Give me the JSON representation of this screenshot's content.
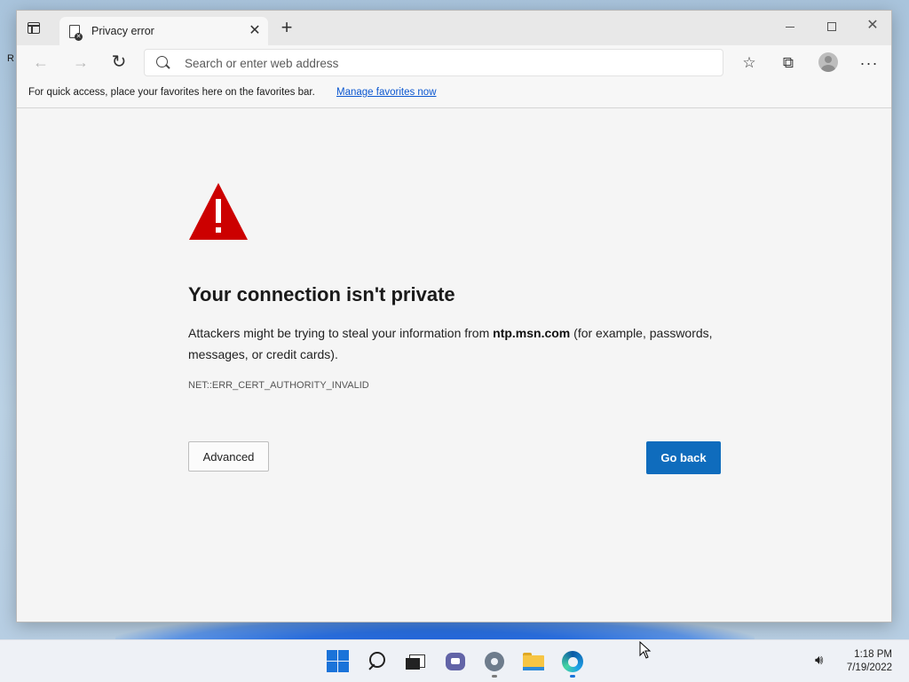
{
  "desktop": {
    "edge_glyph": "R"
  },
  "browser": {
    "tab": {
      "title": "Privacy error",
      "favicon": "error-page-icon"
    },
    "toolbar": {
      "address_placeholder": "Search or enter web address",
      "icons": [
        "back-arrow-icon",
        "forward-arrow-icon",
        "refresh-icon",
        "favorites-icon",
        "collections-icon",
        "profile-avatar",
        "more-icon"
      ]
    },
    "favorites_bar": {
      "text": "For quick access, place your favorites here on the favorites bar.",
      "link": "Manage favorites now"
    }
  },
  "error_page": {
    "heading": "Your connection isn't private",
    "body_prefix": "Attackers might be trying to steal your information from ",
    "domain": "ntp.msn.com",
    "body_suffix": " (for example, passwords, messages, or credit cards).",
    "error_code": "NET::ERR_CERT_AUTHORITY_INVALID",
    "advanced_label": "Advanced",
    "go_back_label": "Go back",
    "warning_color": "#cc0000",
    "primary_button_color": "#0f6cbd"
  },
  "taskbar": {
    "apps": [
      "start-icon",
      "search-icon",
      "task-view-icon",
      "chat-icon",
      "settings-icon",
      "file-explorer-icon",
      "edge-icon"
    ],
    "time": "1:18 PM",
    "date": "7/19/2022"
  }
}
